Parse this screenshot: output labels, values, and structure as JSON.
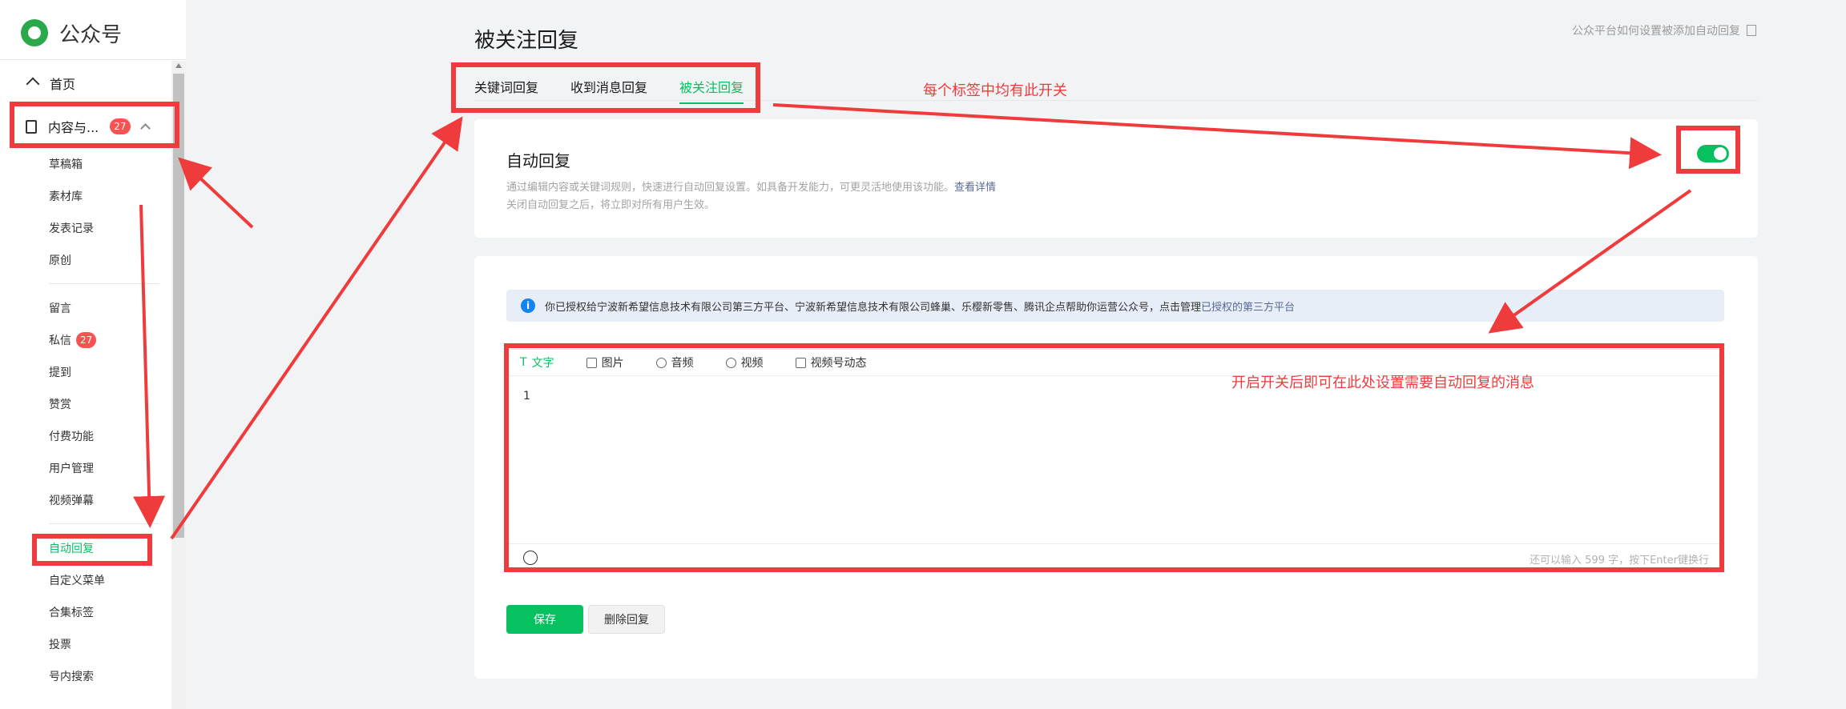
{
  "app": {
    "name": "公众号"
  },
  "sidebar": {
    "home": "首页",
    "content": {
      "label": "内容与...",
      "badge": "27"
    },
    "content_items": [
      "草稿箱",
      "素材库",
      "发表记录",
      "原创"
    ],
    "interact_items": [
      {
        "label": "留言"
      },
      {
        "label": "私信",
        "badge": "27"
      },
      {
        "label": "提到"
      },
      {
        "label": "赞赏"
      },
      {
        "label": "付费功能"
      },
      {
        "label": "用户管理"
      },
      {
        "label": "视频弹幕"
      }
    ],
    "feature_items": [
      "自动回复",
      "自定义菜单",
      "合集标签",
      "投票",
      "号内搜索"
    ]
  },
  "page": {
    "title": "被关注回复",
    "help_link": "公众平台如何设置被添加自动回复",
    "tabs": [
      "关键词回复",
      "收到消息回复",
      "被关注回复"
    ],
    "active_tab": "被关注回复"
  },
  "auto_reply": {
    "title": "自动回复",
    "desc_line1": "通过编辑内容或关键词规则，快速进行自动回复设置。如具备开发能力，可更灵活地使用该功能。",
    "desc_link": "查看详情",
    "desc_line2": "关闭自动回复之后，将立即对所有用户生效。",
    "toggle_on": true
  },
  "notice": {
    "text": "你已授权给宁波新希望信息技术有限公司第三方平台、宁波新希望信息技术有限公司蜂巢、乐樱新零售、腾讯企点帮助你运营公众号，点击管理",
    "link": "已授权的第三方平台"
  },
  "editor": {
    "tabs": [
      {
        "label": "文字",
        "icon": "text-icon"
      },
      {
        "label": "图片",
        "icon": "image-icon"
      },
      {
        "label": "音频",
        "icon": "audio-icon"
      },
      {
        "label": "视频",
        "icon": "video-icon"
      },
      {
        "label": "视频号动态",
        "icon": "channels-icon"
      }
    ],
    "content": "1",
    "counter": "还可以输入 599 字，按下Enter键换行"
  },
  "buttons": {
    "save": "保存",
    "delete": "删除回复"
  },
  "annotations": {
    "tabs_note": "每个标签中均有此开关",
    "editor_note": "开启开关后即可在此处设置需要自动回复的消息"
  },
  "colors": {
    "accent": "#07c160",
    "annotation": "#ef3b3b",
    "badge": "#fa5151",
    "link": "#576b95"
  }
}
